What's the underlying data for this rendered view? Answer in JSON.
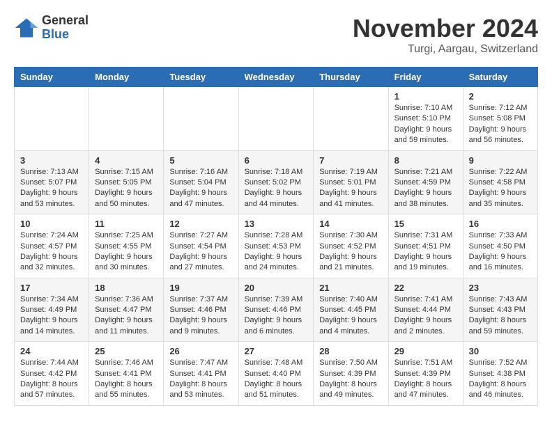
{
  "logo": {
    "general": "General",
    "blue": "Blue"
  },
  "title": "November 2024",
  "location": "Turgi, Aargau, Switzerland",
  "days_of_week": [
    "Sunday",
    "Monday",
    "Tuesday",
    "Wednesday",
    "Thursday",
    "Friday",
    "Saturday"
  ],
  "weeks": [
    {
      "days": [
        {
          "number": "",
          "info": ""
        },
        {
          "number": "",
          "info": ""
        },
        {
          "number": "",
          "info": ""
        },
        {
          "number": "",
          "info": ""
        },
        {
          "number": "",
          "info": ""
        },
        {
          "number": "1",
          "info": "Sunrise: 7:10 AM\nSunset: 5:10 PM\nDaylight: 9 hours and 59 minutes."
        },
        {
          "number": "2",
          "info": "Sunrise: 7:12 AM\nSunset: 5:08 PM\nDaylight: 9 hours and 56 minutes."
        }
      ]
    },
    {
      "days": [
        {
          "number": "3",
          "info": "Sunrise: 7:13 AM\nSunset: 5:07 PM\nDaylight: 9 hours and 53 minutes."
        },
        {
          "number": "4",
          "info": "Sunrise: 7:15 AM\nSunset: 5:05 PM\nDaylight: 9 hours and 50 minutes."
        },
        {
          "number": "5",
          "info": "Sunrise: 7:16 AM\nSunset: 5:04 PM\nDaylight: 9 hours and 47 minutes."
        },
        {
          "number": "6",
          "info": "Sunrise: 7:18 AM\nSunset: 5:02 PM\nDaylight: 9 hours and 44 minutes."
        },
        {
          "number": "7",
          "info": "Sunrise: 7:19 AM\nSunset: 5:01 PM\nDaylight: 9 hours and 41 minutes."
        },
        {
          "number": "8",
          "info": "Sunrise: 7:21 AM\nSunset: 4:59 PM\nDaylight: 9 hours and 38 minutes."
        },
        {
          "number": "9",
          "info": "Sunrise: 7:22 AM\nSunset: 4:58 PM\nDaylight: 9 hours and 35 minutes."
        }
      ]
    },
    {
      "days": [
        {
          "number": "10",
          "info": "Sunrise: 7:24 AM\nSunset: 4:57 PM\nDaylight: 9 hours and 32 minutes."
        },
        {
          "number": "11",
          "info": "Sunrise: 7:25 AM\nSunset: 4:55 PM\nDaylight: 9 hours and 30 minutes."
        },
        {
          "number": "12",
          "info": "Sunrise: 7:27 AM\nSunset: 4:54 PM\nDaylight: 9 hours and 27 minutes."
        },
        {
          "number": "13",
          "info": "Sunrise: 7:28 AM\nSunset: 4:53 PM\nDaylight: 9 hours and 24 minutes."
        },
        {
          "number": "14",
          "info": "Sunrise: 7:30 AM\nSunset: 4:52 PM\nDaylight: 9 hours and 21 minutes."
        },
        {
          "number": "15",
          "info": "Sunrise: 7:31 AM\nSunset: 4:51 PM\nDaylight: 9 hours and 19 minutes."
        },
        {
          "number": "16",
          "info": "Sunrise: 7:33 AM\nSunset: 4:50 PM\nDaylight: 9 hours and 16 minutes."
        }
      ]
    },
    {
      "days": [
        {
          "number": "17",
          "info": "Sunrise: 7:34 AM\nSunset: 4:49 PM\nDaylight: 9 hours and 14 minutes."
        },
        {
          "number": "18",
          "info": "Sunrise: 7:36 AM\nSunset: 4:47 PM\nDaylight: 9 hours and 11 minutes."
        },
        {
          "number": "19",
          "info": "Sunrise: 7:37 AM\nSunset: 4:46 PM\nDaylight: 9 hours and 9 minutes."
        },
        {
          "number": "20",
          "info": "Sunrise: 7:39 AM\nSunset: 4:46 PM\nDaylight: 9 hours and 6 minutes."
        },
        {
          "number": "21",
          "info": "Sunrise: 7:40 AM\nSunset: 4:45 PM\nDaylight: 9 hours and 4 minutes."
        },
        {
          "number": "22",
          "info": "Sunrise: 7:41 AM\nSunset: 4:44 PM\nDaylight: 9 hours and 2 minutes."
        },
        {
          "number": "23",
          "info": "Sunrise: 7:43 AM\nSunset: 4:43 PM\nDaylight: 8 hours and 59 minutes."
        }
      ]
    },
    {
      "days": [
        {
          "number": "24",
          "info": "Sunrise: 7:44 AM\nSunset: 4:42 PM\nDaylight: 8 hours and 57 minutes."
        },
        {
          "number": "25",
          "info": "Sunrise: 7:46 AM\nSunset: 4:41 PM\nDaylight: 8 hours and 55 minutes."
        },
        {
          "number": "26",
          "info": "Sunrise: 7:47 AM\nSunset: 4:41 PM\nDaylight: 8 hours and 53 minutes."
        },
        {
          "number": "27",
          "info": "Sunrise: 7:48 AM\nSunset: 4:40 PM\nDaylight: 8 hours and 51 minutes."
        },
        {
          "number": "28",
          "info": "Sunrise: 7:50 AM\nSunset: 4:39 PM\nDaylight: 8 hours and 49 minutes."
        },
        {
          "number": "29",
          "info": "Sunrise: 7:51 AM\nSunset: 4:39 PM\nDaylight: 8 hours and 47 minutes."
        },
        {
          "number": "30",
          "info": "Sunrise: 7:52 AM\nSunset: 4:38 PM\nDaylight: 8 hours and 46 minutes."
        }
      ]
    }
  ]
}
